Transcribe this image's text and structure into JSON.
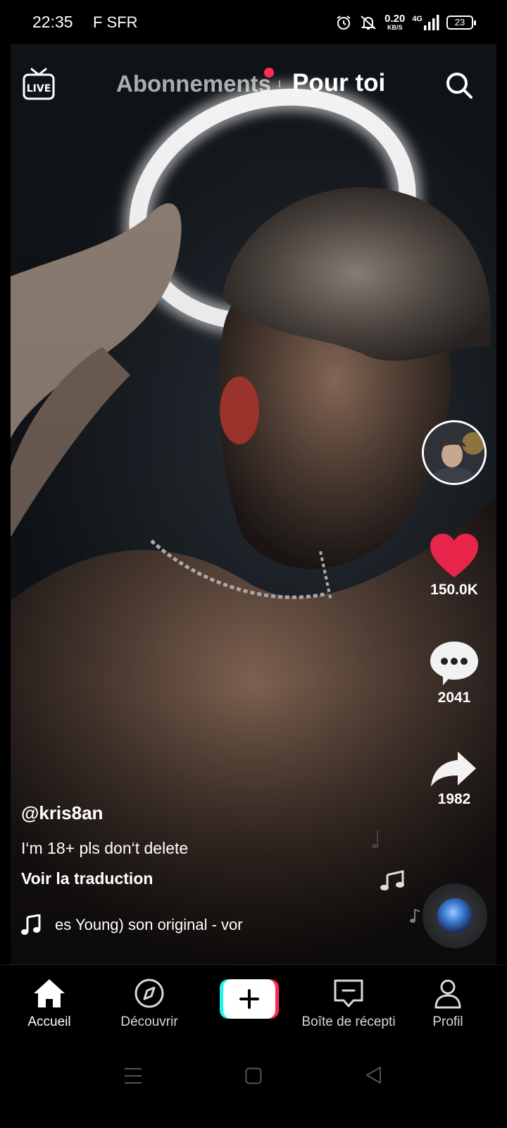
{
  "status_bar": {
    "time": "22:35",
    "carrier": "F SFR",
    "speed_value": "0.20",
    "speed_unit": "KB/S",
    "network": "4G",
    "battery": "23"
  },
  "top_nav": {
    "live_label": "LIVE",
    "tab_following": "Abonnements",
    "tab_for_you": "Pour toi",
    "notification_dot_color": "#ff2d55"
  },
  "actions": {
    "likes": "150.0K",
    "comments": "2041",
    "shares": "1982",
    "like_color": "#e8254a"
  },
  "post": {
    "username": "@kris8an",
    "caption": "I‘m 18+ pls don‘t delete",
    "translate_label": "Voir la traduction",
    "music_text": "es Young)    son original - vor"
  },
  "bottom_nav": {
    "home": "Accueil",
    "discover": "Découvrir",
    "inbox": "Boîte de récepti",
    "profile": "Profil",
    "create_accent_left": "#25f4ee",
    "create_accent_right": "#fe2c55"
  },
  "icons": [
    "live-icon",
    "search-icon",
    "heart-icon",
    "comment-icon",
    "share-icon",
    "music-note-icon",
    "home-icon",
    "compass-icon",
    "inbox-icon",
    "profile-icon",
    "plus-icon"
  ]
}
